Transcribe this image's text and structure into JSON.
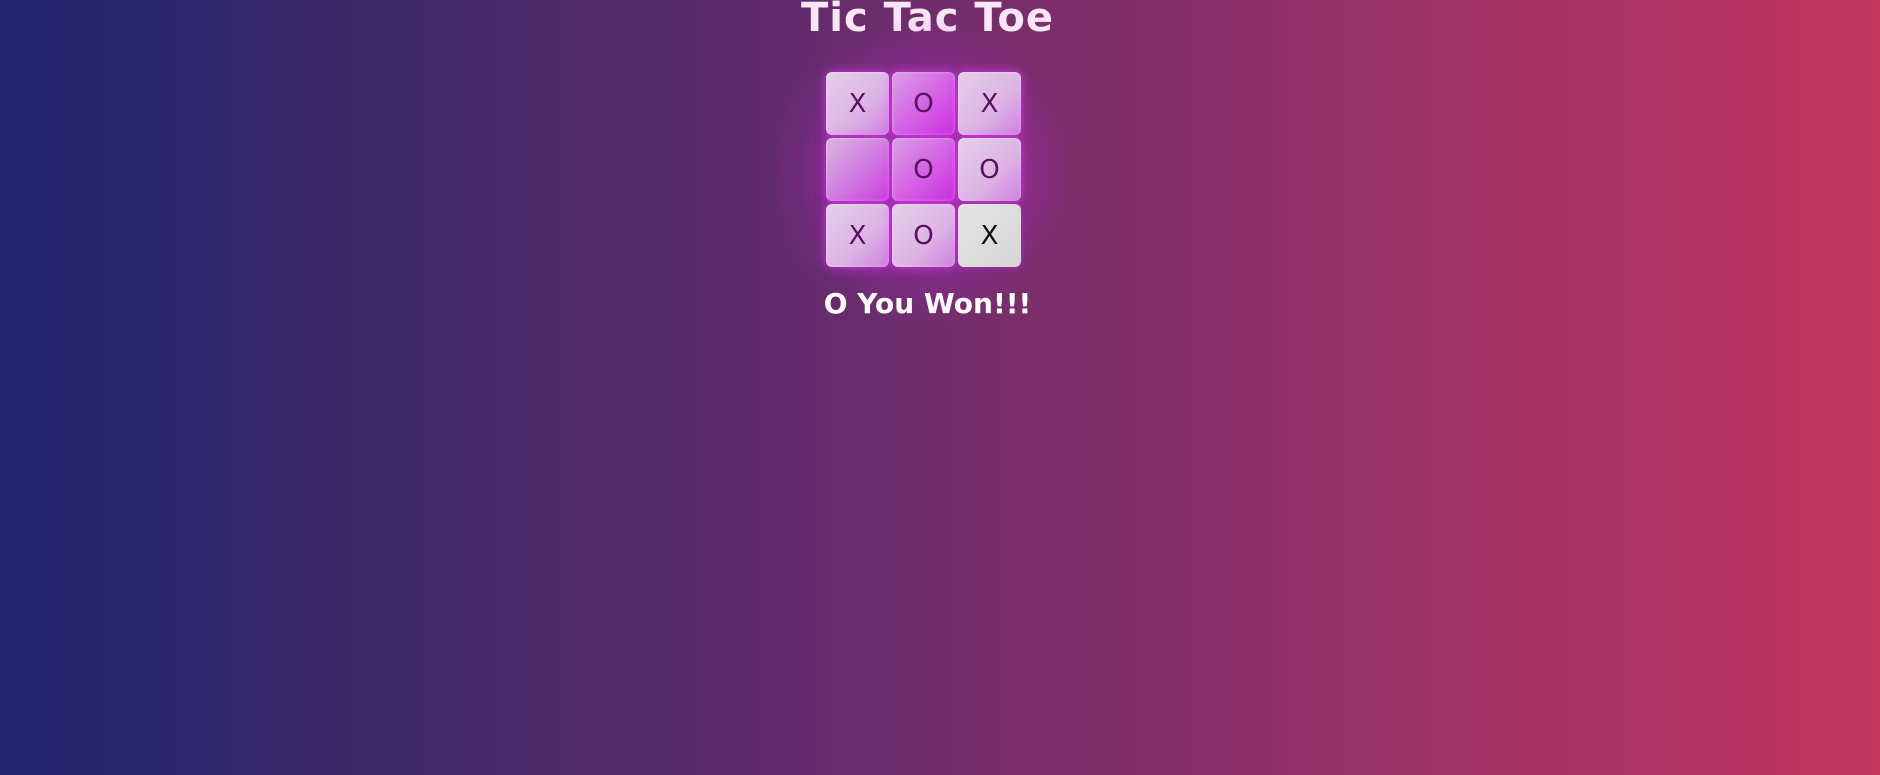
{
  "game": {
    "title": "Tic Tac Toe",
    "status": "O You Won!!!",
    "board": [
      [
        "X",
        "O",
        "X"
      ],
      [
        "",
        "O",
        "O"
      ],
      [
        "X",
        "O",
        "X"
      ]
    ],
    "colors": {
      "cell_glow": "#cc3ddd",
      "mark": "#5a1060",
      "background_start": "#1f246f",
      "background_end": "#c23660"
    }
  }
}
